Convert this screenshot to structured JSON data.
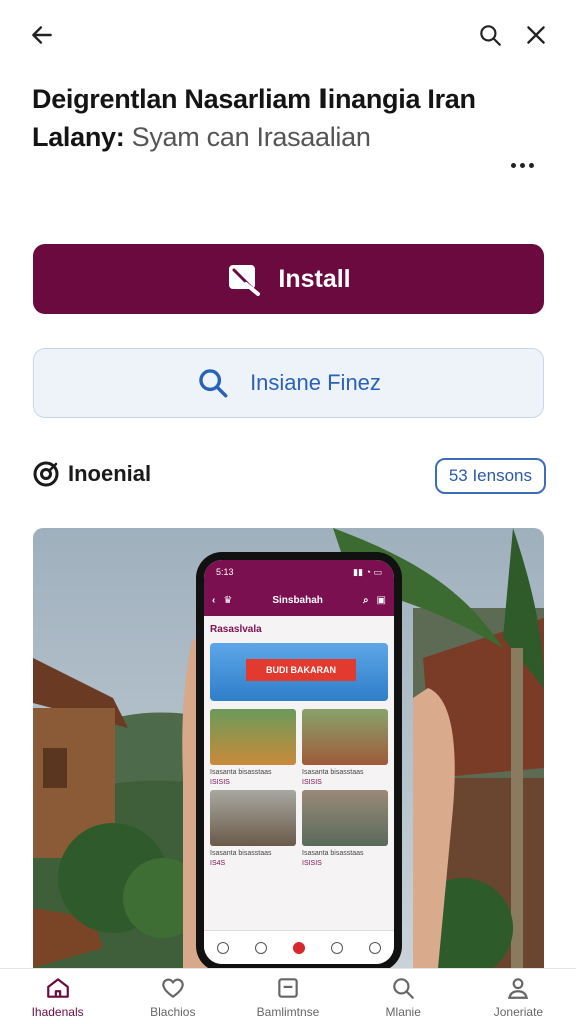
{
  "header": {
    "back_icon": "arrow-left-icon",
    "search_icon": "search-icon",
    "close_icon": "close-icon"
  },
  "title": {
    "main": "Deigrentlan Nasarliam Ⅰinangia Iran Lalany:",
    "sub": "Syam can Irasaalian"
  },
  "more_icon": "more-horizontal-icon",
  "install_button": {
    "label": "Install",
    "icon": "app-install-icon",
    "color": "#6b0a3f"
  },
  "inspect_button": {
    "label": "Insiane Finez",
    "icon": "search-icon",
    "color": "#2a62b8"
  },
  "section": {
    "title": "Inoenial",
    "icon": "target-icon",
    "badge": "53 Iensons"
  },
  "preview": {
    "status_time": "5:13",
    "app_title": "Sinsbahah",
    "section_label": "Rasaslvala",
    "banner_text": "BUDI BAKARAN",
    "cards": [
      {
        "caption": "Isasanta bisasstaas",
        "meta": "ISISIS"
      },
      {
        "caption": "Isasanta bisasstaas",
        "meta": "ISISIS"
      },
      {
        "caption": "Isasanta bisasstaas",
        "meta": "IS4S"
      },
      {
        "caption": "Isasanta bisasstaas",
        "meta": "ISISIS"
      }
    ]
  },
  "bottom_nav": [
    {
      "label": "Ihadenals",
      "icon": "home-icon",
      "active": true
    },
    {
      "label": "Blachios",
      "icon": "heart-icon",
      "active": false
    },
    {
      "label": "Bamlimtnse",
      "icon": "minus-square-icon",
      "active": false
    },
    {
      "label": "Mlanie",
      "icon": "search-icon",
      "active": false
    },
    {
      "label": "Joneriate",
      "icon": "person-icon",
      "active": false
    }
  ]
}
